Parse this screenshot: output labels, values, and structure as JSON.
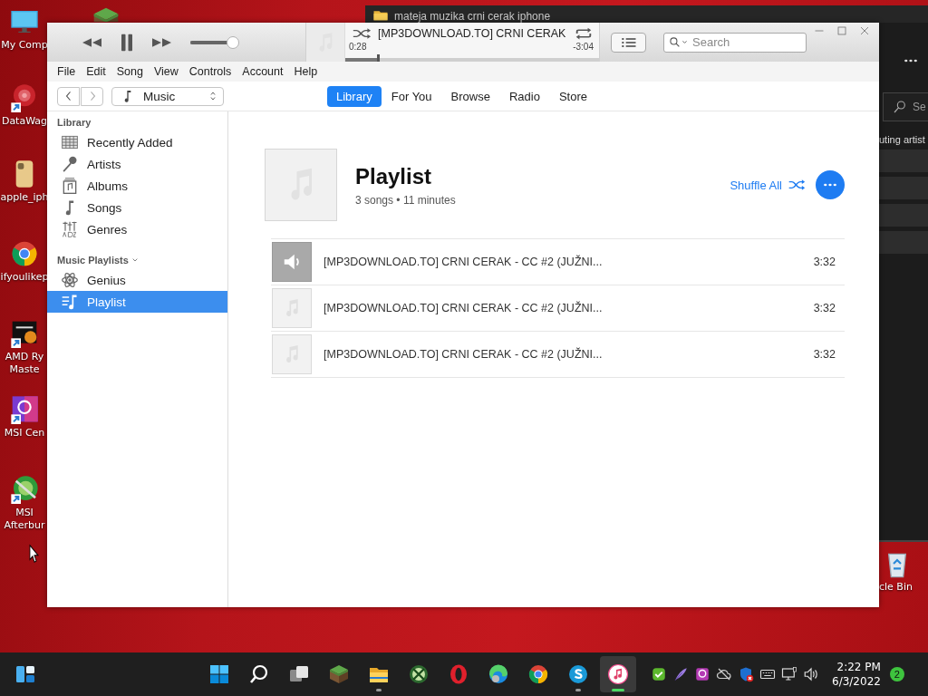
{
  "desktop": {
    "icons": [
      {
        "kind": "computer",
        "label": "My Comp"
      },
      {
        "kind": "grass-block"
      },
      {
        "kind": "datawag",
        "label": "DataWag"
      },
      {
        "kind": "phone",
        "label": "apple_iph"
      },
      {
        "kind": "chrome",
        "label": "ifyoulikep"
      },
      {
        "kind": "ryzen",
        "label": "AMD Ry Maste"
      },
      {
        "kind": "msi-center",
        "label": "MSI Cen"
      },
      {
        "kind": "afterburner",
        "label": "MSI Afterbur"
      },
      {
        "kind": "recycle-bin",
        "label": "cle Bin"
      }
    ]
  },
  "background_window": {
    "title": "mateja muzika crni cerak iphone",
    "search": {
      "placeholder": "Se"
    },
    "subtitle": "uting artist"
  },
  "itunes": {
    "player": {
      "volume": {
        "level": 0.85
      },
      "now_playing": {
        "title": "[MP3DOWNLOAD.TO] CRNI CERAK",
        "elapsed": "0:28",
        "remaining": "-3:04",
        "level": 0.13
      },
      "search": {
        "placeholder": "Search"
      }
    },
    "menu": [
      "File",
      "Edit",
      "Song",
      "View",
      "Controls",
      "Account",
      "Help"
    ],
    "source": "Music",
    "tabs": [
      {
        "label": "Library",
        "selected": true
      },
      {
        "label": "For You",
        "selected": false
      },
      {
        "label": "Browse",
        "selected": false
      },
      {
        "label": "Radio",
        "selected": false
      },
      {
        "label": "Store",
        "selected": false
      }
    ],
    "sidebar": {
      "sections": [
        {
          "title": "Library",
          "items": [
            {
              "kind": "recent",
              "label": "Recently Added",
              "selected": false
            },
            {
              "kind": "artists",
              "label": "Artists",
              "selected": false
            },
            {
              "kind": "albums",
              "label": "Albums",
              "selected": false
            },
            {
              "kind": "songs",
              "label": "Songs",
              "selected": false
            },
            {
              "kind": "genres",
              "label": "Genres",
              "selected": false
            }
          ]
        },
        {
          "title": "Music Playlists",
          "items": [
            {
              "kind": "genius",
              "label": "Genius",
              "selected": false
            },
            {
              "kind": "playlist",
              "label": "Playlist",
              "selected": true
            }
          ]
        }
      ]
    },
    "playlist": {
      "title": "Playlist",
      "summary": "3 songs • 11 minutes",
      "shuffle": "Shuffle All",
      "songs": [
        {
          "title": "[MP3DOWNLOAD.TO] CRNI CERAK - CC #2 (JUŽNI...",
          "duration": "3:32",
          "playing": true
        },
        {
          "title": "[MP3DOWNLOAD.TO] CRNI CERAK - CC #2 (JUŽNI...",
          "duration": "3:32",
          "playing": false
        },
        {
          "title": "[MP3DOWNLOAD.TO] CRNI CERAK - CC #2 (JUŽNI...",
          "duration": "3:32",
          "playing": false
        }
      ]
    }
  },
  "taskbar": {
    "apps": [
      {
        "kind": "start",
        "running": false,
        "selected": false
      },
      {
        "kind": "search",
        "running": false,
        "selected": false
      },
      {
        "kind": "taskview",
        "running": false,
        "selected": false
      },
      {
        "kind": "grass-block",
        "running": false,
        "selected": false
      },
      {
        "kind": "explorer",
        "running": true,
        "selected": false
      },
      {
        "kind": "xbox",
        "running": false,
        "selected": false
      },
      {
        "kind": "opera",
        "running": false,
        "selected": false
      },
      {
        "kind": "edge",
        "running": false,
        "selected": false
      },
      {
        "kind": "chrome",
        "running": false,
        "selected": false
      },
      {
        "kind": "skype",
        "running": true,
        "selected": false
      },
      {
        "kind": "itunes",
        "running": true,
        "selected": true
      }
    ],
    "tray": [
      {
        "kind": "check"
      },
      {
        "kind": "pen"
      },
      {
        "kind": "msi"
      },
      {
        "kind": "cloud-off"
      },
      {
        "kind": "defender"
      },
      {
        "kind": "keyboard"
      },
      {
        "kind": "network"
      },
      {
        "kind": "volume"
      }
    ],
    "clock": {
      "time": "2:22 PM",
      "date": "6/3/2022"
    },
    "notifications": "2"
  }
}
